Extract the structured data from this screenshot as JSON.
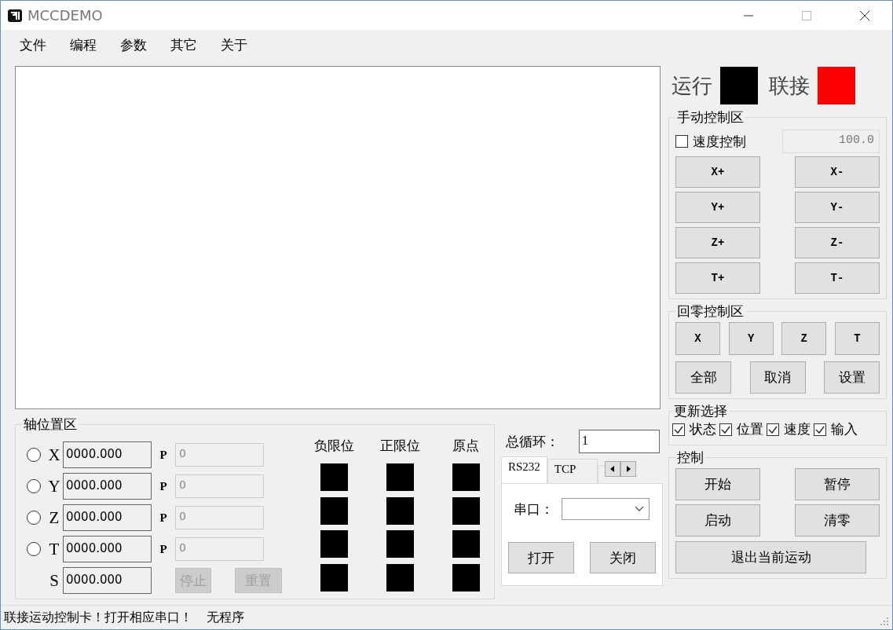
{
  "window": {
    "title": "MCCDEMO"
  },
  "menu": [
    "文件",
    "编程",
    "参数",
    "其它",
    "关于"
  ],
  "indicators": [
    {
      "label": "运行",
      "color": "#000000"
    },
    {
      "label": "联接",
      "color": "#ff0000"
    }
  ],
  "manual": {
    "title": "手动控制区",
    "speed_control": {
      "label": "速度控制",
      "checked": false
    },
    "speed_value": "100.0",
    "buttons": [
      "X+",
      "X-",
      "Y+",
      "Y-",
      "Z+",
      "Z-",
      "T+",
      "T-"
    ]
  },
  "homing": {
    "title": "回零控制区",
    "axis_buttons": [
      "X",
      "Y",
      "Z",
      "T"
    ],
    "buttons": [
      "全部",
      "取消",
      "设置"
    ]
  },
  "update": {
    "title": "更新选择",
    "options": [
      {
        "label": "状态",
        "checked": true
      },
      {
        "label": "位置",
        "checked": true
      },
      {
        "label": "速度",
        "checked": true
      },
      {
        "label": "输入",
        "checked": true
      }
    ]
  },
  "control": {
    "title": "控制",
    "buttons": [
      "开始",
      "暂停",
      "启动",
      "清零"
    ],
    "exit_button": "退出当前运动"
  },
  "axis_position": {
    "title": "轴位置区",
    "axes": [
      {
        "kind": "radio",
        "selected": false,
        "label": "X",
        "value": "0000.000",
        "p_label": "P",
        "p_value": "0"
      },
      {
        "kind": "radio",
        "selected": false,
        "label": "Y",
        "value": "0000.000",
        "p_label": "P",
        "p_value": "0"
      },
      {
        "kind": "radio",
        "selected": false,
        "label": "Z",
        "value": "0000.000",
        "p_label": "P",
        "p_value": "0"
      },
      {
        "kind": "radio",
        "selected": false,
        "label": "T",
        "value": "0000.000",
        "p_label": "P",
        "p_value": "0"
      },
      {
        "kind": "plain",
        "label": "S",
        "value": "0000.000"
      }
    ],
    "action_buttons": [
      {
        "label": "停止",
        "disabled": true
      },
      {
        "label": "重置",
        "disabled": true
      }
    ],
    "limit_headers": [
      "负限位",
      "正限位",
      "原点"
    ],
    "lamps": [
      [
        {
          "color": "#000000"
        },
        {
          "color": "#000000"
        },
        {
          "color": "#000000"
        }
      ],
      [
        {
          "color": "#000000"
        },
        {
          "color": "#000000"
        },
        {
          "color": "#000000"
        }
      ],
      [
        {
          "color": "#000000"
        },
        {
          "color": "#000000"
        },
        {
          "color": "#000000"
        }
      ],
      [
        {
          "color": "#000000"
        },
        {
          "color": "#000000"
        },
        {
          "color": "#000000"
        }
      ]
    ]
  },
  "loop": {
    "label": "总循环：",
    "value": "1"
  },
  "comm_tabs": [
    {
      "label": "RS232",
      "selected": true
    },
    {
      "label": "TCP",
      "selected": false
    }
  ],
  "serial": {
    "label": "串口：",
    "buttons": [
      "打开",
      "关闭"
    ]
  },
  "status_bar": [
    "联接运动控制卡！打开相应串口！",
    "无程序"
  ]
}
